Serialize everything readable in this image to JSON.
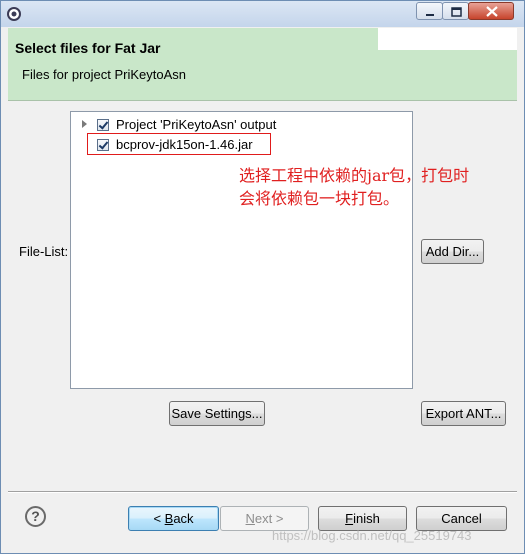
{
  "header": {
    "title": "Select files for Fat Jar",
    "subtitle": "Files for project PriKeytoAsn"
  },
  "file_list": {
    "label": "File-List:",
    "items": [
      {
        "label": "Project 'PriKeytoAsn' output",
        "checked": true,
        "expandable": true
      },
      {
        "label": "bcprov-jdk15on-1.46.jar",
        "checked": true,
        "expandable": false
      }
    ]
  },
  "annotation": {
    "line1": "选择工程中依赖的jar包，打包时",
    "line2": "会将依赖包一块打包。",
    "color": "#e02020"
  },
  "buttons": {
    "add_dir": "Add Dir...",
    "save_settings": "Save Settings...",
    "export_ant": "Export ANT...",
    "back_prefix": "< ",
    "back_mnemonic": "B",
    "back_rest": "ack",
    "next_mnemonic": "N",
    "next_rest": "ext >",
    "finish_mnemonic": "F",
    "finish_rest": "inish",
    "cancel": "Cancel"
  },
  "help": {
    "glyph": "?"
  },
  "watermark": "https://blog.csdn.net/qq_25519743",
  "colors": {
    "header_bg": "#c9e7c9",
    "annotation": "#e02020",
    "highlight_box": "#e01b1b"
  },
  "icons": [
    "app-icon",
    "minimize-icon",
    "maximize-icon",
    "close-icon",
    "expand-arrow-icon",
    "checkbox-icon",
    "help-icon"
  ]
}
